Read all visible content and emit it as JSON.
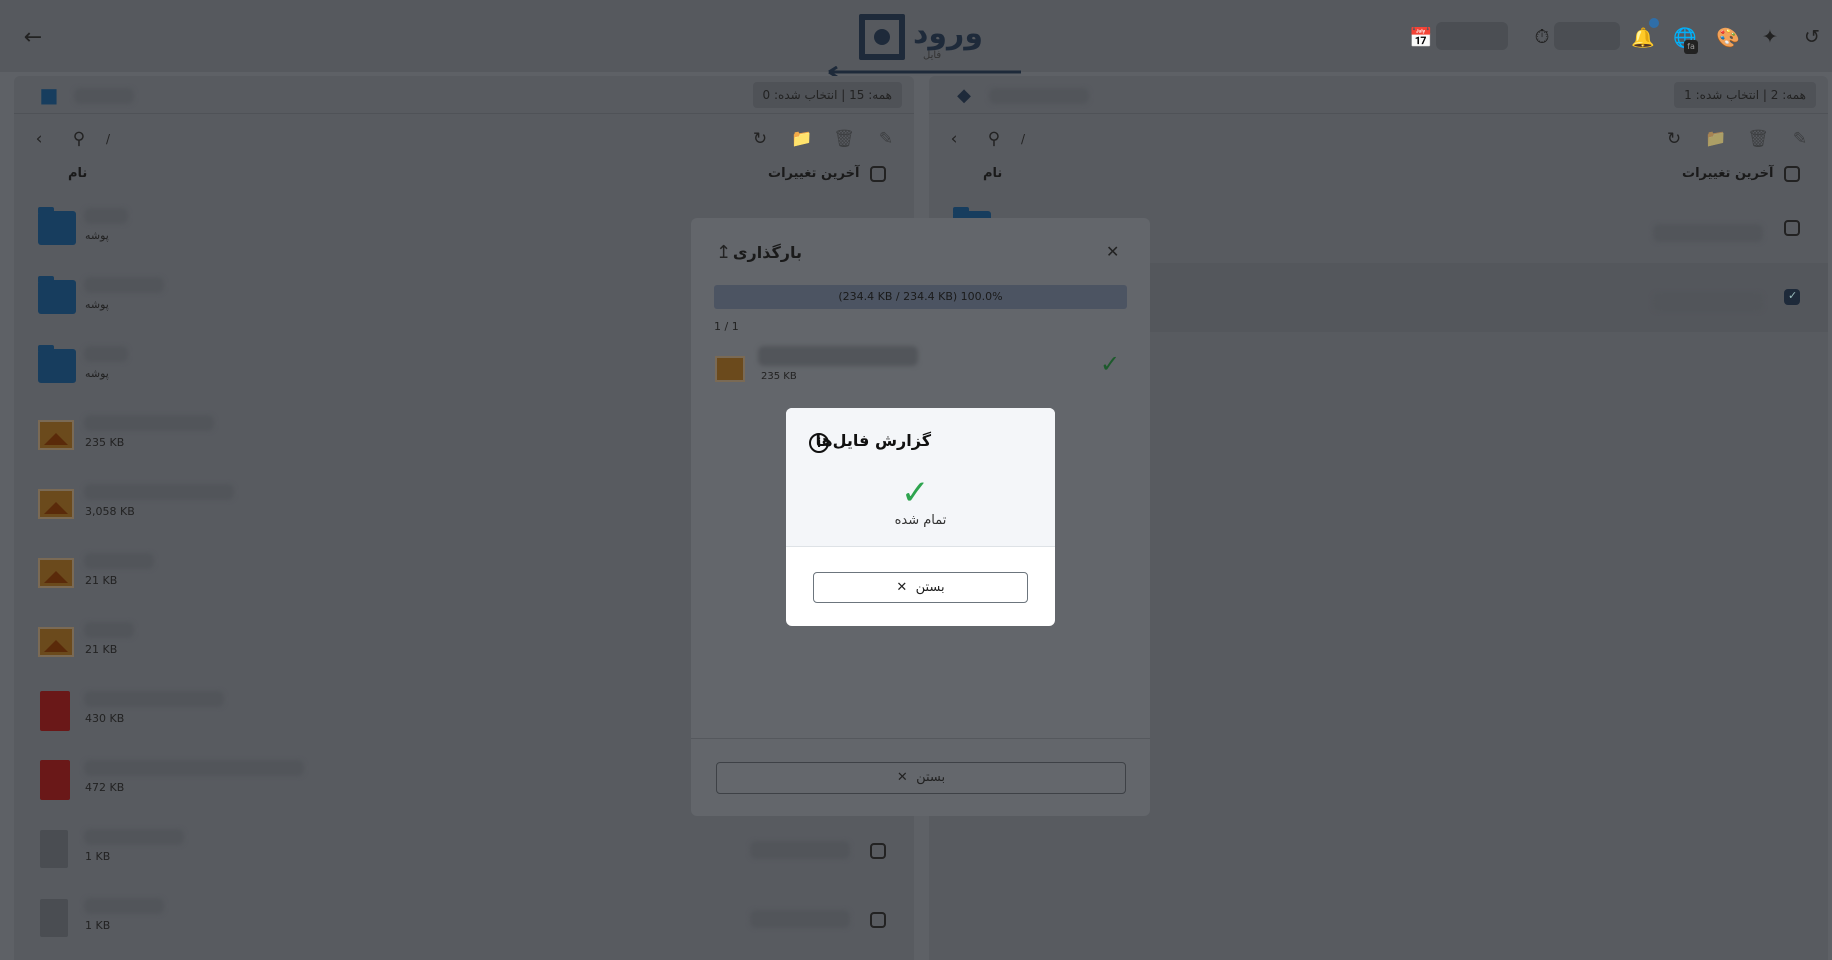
{
  "header": {
    "logo_text": "ورود",
    "logo_sub": "فایل"
  },
  "left_panel": {
    "selection_counter": "همه: 15  |  انتخاب شده: 0",
    "path": "/",
    "col_name": "نام",
    "col_modified": "آخرین تغییرات",
    "rows": [
      {
        "icon": "folder",
        "meta": "پوشه"
      },
      {
        "icon": "folder",
        "meta": "پوشه"
      },
      {
        "icon": "folder",
        "meta": "پوشه"
      },
      {
        "icon": "image",
        "meta": "235 KB"
      },
      {
        "icon": "image",
        "meta": "3,058 KB"
      },
      {
        "icon": "image",
        "meta": "21 KB"
      },
      {
        "icon": "image",
        "meta": "21 KB"
      },
      {
        "icon": "pdf",
        "meta": "430 KB"
      },
      {
        "icon": "pdf",
        "meta": "472 KB"
      },
      {
        "icon": "file",
        "meta": "1 KB"
      },
      {
        "icon": "file",
        "meta": "1 KB"
      }
    ]
  },
  "right_panel": {
    "selection_counter": "همه: 2  |  انتخاب شده: 1",
    "path": "/",
    "col_name": "نام",
    "col_modified": "آخرین تغییرات"
  },
  "upload_dialog": {
    "title": "بارگذاری",
    "progress_text": "(234.4 KB / 234.4 KB)  100.0%",
    "progress": 1.0,
    "file_count": "1 / 1",
    "file_size": "235 KB",
    "close_label": "بستن"
  },
  "report_modal": {
    "title": "گزارش فایل‌ها",
    "status": "تمام شده",
    "close_label": "بستن"
  },
  "colors": {
    "success": "#2ea44f",
    "brand": "#1e2a3a"
  }
}
